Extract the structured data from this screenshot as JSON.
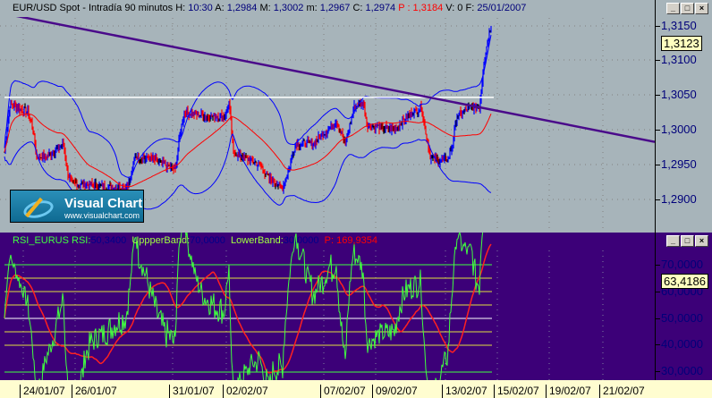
{
  "price_panel": {
    "title": "EUR/USD Spot - Intradía 90 minutos",
    "fields": [
      {
        "k": "H:",
        "v": "10:30"
      },
      {
        "k": "A:",
        "v": "1,2984"
      },
      {
        "k": "M:",
        "v": "1,3002"
      },
      {
        "k": "m:",
        "v": "1,2967"
      },
      {
        "k": "C:",
        "v": "1,2974"
      }
    ],
    "p_label": "P : 1,3184",
    "v_label": "V: 0",
    "f_key": "F:",
    "f_val": "25/01/2007",
    "axis": [
      "1,3150",
      "1,3100",
      "1,3050",
      "1,3000",
      "1,2950",
      "1,2900"
    ],
    "current": "1,3123"
  },
  "rsi_panel": {
    "name": "RSI_EURUS",
    "rsi_key": "RSI:",
    "rsi_val": "50,3400",
    "upper_key": "UppperBand:",
    "upper_val": "70,0000",
    "lower_key": "LowerBand:",
    "lower_val": "30,0000",
    "p": "P: 169,9354",
    "axis": [
      "70,0000",
      "60,0000",
      "50,0000",
      "40,0000",
      "30,0000"
    ],
    "current": "63,4186"
  },
  "logo": {
    "name": "Visual Chart",
    "url": "www.visualchart.com"
  },
  "dates": [
    "24/01/07",
    "26/01/07",
    "31/01/07",
    "02/02/07",
    "07/02/07",
    "09/02/07",
    "13/02/07",
    "15/02/07",
    "19/02/07",
    "21/02/07"
  ],
  "window_buttons": [
    "_",
    "□",
    "×"
  ],
  "colors": {
    "up": "#0000ff",
    "down": "#ff0000",
    "neutral": "#000000",
    "ma": "#ff0000",
    "bands": "#0000ff",
    "trend": "#4a0a8a"
  },
  "chart_data": {
    "type": "line",
    "price_keypoints": [
      [
        0,
        1.2968
      ],
      [
        6,
        1.3037
      ],
      [
        26,
        1.3026
      ],
      [
        31,
        1.3007
      ],
      [
        36,
        1.2962
      ],
      [
        46,
        1.2962
      ],
      [
        56,
        1.2968
      ],
      [
        66,
        1.2981
      ],
      [
        71,
        1.2936
      ],
      [
        76,
        1.2923
      ],
      [
        96,
        1.2921
      ],
      [
        116,
        1.2917
      ],
      [
        136,
        1.2917
      ],
      [
        141,
        1.293
      ],
      [
        146,
        1.2962
      ],
      [
        166,
        1.2958
      ],
      [
        181,
        1.2949
      ],
      [
        191,
        1.2943
      ],
      [
        196,
        1.2994
      ],
      [
        201,
        1.3026
      ],
      [
        226,
        1.302
      ],
      [
        246,
        1.302
      ],
      [
        251,
        1.3039
      ],
      [
        256,
        1.2968
      ],
      [
        271,
        1.2958
      ],
      [
        286,
        1.2949
      ],
      [
        296,
        1.293
      ],
      [
        311,
        1.2917
      ],
      [
        316,
        1.2936
      ],
      [
        326,
        1.2981
      ],
      [
        346,
        1.2981
      ],
      [
        371,
        1.3013
      ],
      [
        381,
        1.2981
      ],
      [
        391,
        1.3033
      ],
      [
        401,
        1.3039
      ],
      [
        406,
        1.3007
      ],
      [
        436,
        1.3001
      ],
      [
        451,
        1.302
      ],
      [
        466,
        1.3033
      ],
      [
        476,
        1.2962
      ],
      [
        486,
        1.2955
      ],
      [
        496,
        1.2958
      ],
      [
        501,
        1.2981
      ],
      [
        506,
        1.302
      ],
      [
        521,
        1.3033
      ],
      [
        531,
        1.3033
      ],
      [
        536,
        1.3097
      ],
      [
        541,
        1.3136
      ],
      [
        544,
        1.3149
      ]
    ],
    "trendline": [
      1.3169,
      1.2983
    ],
    "resistance": 1.3047,
    "price_range": [
      1.2875,
      1.316
    ],
    "rsi_levels": [
      70,
      65,
      60,
      55,
      50,
      45,
      40,
      30
    ],
    "rsi_range": [
      24,
      78
    ]
  }
}
